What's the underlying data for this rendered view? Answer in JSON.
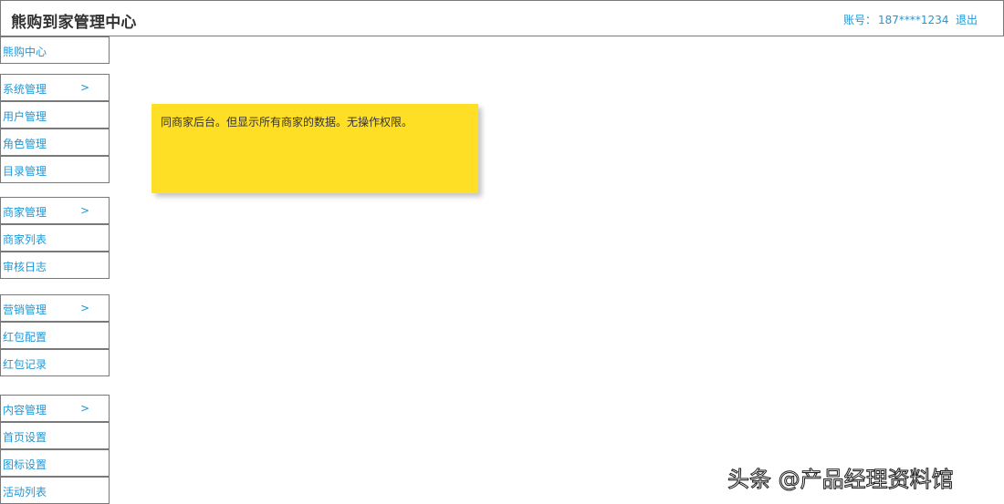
{
  "header": {
    "title": "熊购到家管理中心",
    "account_label": "账号：",
    "account_value": "187****1234",
    "logout": "退出"
  },
  "sidebar": {
    "home": "熊购中心",
    "groups": [
      {
        "label": "系统管理",
        "chevron": ">",
        "items": [
          "用户管理",
          "角色管理",
          "目录管理"
        ]
      },
      {
        "label": "商家管理",
        "chevron": ">",
        "items": [
          "商家列表",
          "审核日志"
        ]
      },
      {
        "label": "营销管理",
        "chevron": ">",
        "items": [
          "红包配置",
          "红包记录"
        ]
      },
      {
        "label": "内容管理",
        "chevron": ">",
        "items": [
          "首页设置",
          "图标设置",
          "活动列表"
        ]
      }
    ]
  },
  "note": {
    "text": "同商家后台。但显示所有商家的数据。无操作权限。"
  },
  "watermark": "头条 @产品经理资料馆",
  "colors": {
    "link": "#1e98d7",
    "border": "#797979",
    "note_bg": "#ffdf25",
    "title": "#333333"
  }
}
